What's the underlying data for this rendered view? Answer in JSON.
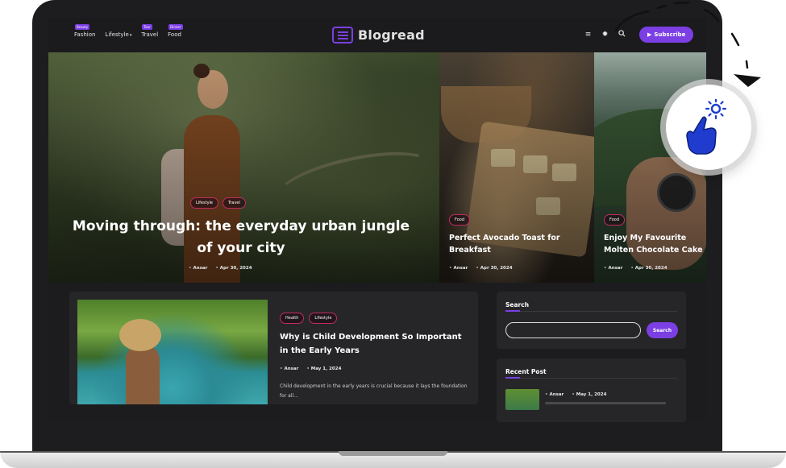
{
  "nav": [
    {
      "label": "Fashion",
      "badge": "Beauty"
    },
    {
      "label": "Lifestyle",
      "badge": ""
    },
    {
      "label": "Travel",
      "badge": "Tour"
    },
    {
      "label": "Food",
      "badge": "Dinner"
    }
  ],
  "logo": {
    "text": "Blogread"
  },
  "header": {
    "subscribe_label": "Subscribe"
  },
  "icons": {
    "menu": "menu-icon",
    "theme": "sun-icon",
    "search": "search-icon",
    "play": "play-icon"
  },
  "colors": {
    "accent": "#7b3fe4",
    "tag_border": "#c12c5f",
    "background": "#1c1c1e"
  },
  "hero_main": {
    "tags": [
      "Lifestyle",
      "Travel"
    ],
    "title": "Moving through: the everyday urban jungle of your city",
    "author": "Ansar",
    "date": "Apr 30, 2024"
  },
  "hero_cards": [
    {
      "tag": "Food",
      "title": "Perfect Avocado Toast for Breakfast",
      "author": "Ansar",
      "date": "Apr 30, 2024"
    },
    {
      "tag": "Food",
      "title": "Enjoy My Favourite Molten Chocolate Cake",
      "author": "Ansar",
      "date": "Apr 30, 2024"
    }
  ],
  "post": {
    "tags": [
      "Health",
      "Lifestyle"
    ],
    "title": "Why is Child Development So Important in the Early Years",
    "author": "Ansar",
    "date": "May 1, 2024",
    "excerpt": "Child development in the early years is crucial because it lays the foundation for all..."
  },
  "search_widget": {
    "title": "Search",
    "button_label": "Search"
  },
  "recent_widget": {
    "title": "Recent Post",
    "author": "Ansar",
    "date": "May 1, 2024"
  }
}
